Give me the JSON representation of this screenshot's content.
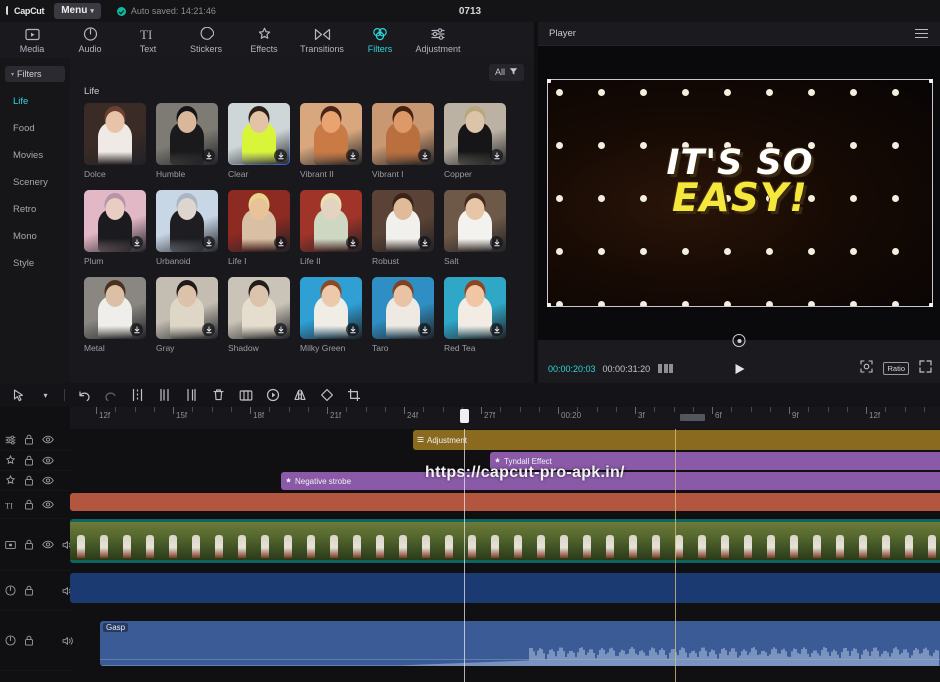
{
  "titlebar": {
    "logo": "CapCut",
    "menu_label": "Menu",
    "menu_caret": "⌄",
    "autosave": "Auto saved: 14:21:46",
    "window_title": "0713"
  },
  "toptabs": [
    {
      "label": "Media",
      "icon": "media-icon",
      "active": false
    },
    {
      "label": "Audio",
      "icon": "audio-icon",
      "active": false
    },
    {
      "label": "Text",
      "icon": "text-icon",
      "active": false
    },
    {
      "label": "Stickers",
      "icon": "stickers-icon",
      "active": false
    },
    {
      "label": "Effects",
      "icon": "effects-icon",
      "active": false
    },
    {
      "label": "Transitions",
      "icon": "transitions-icon",
      "active": false
    },
    {
      "label": "Filters",
      "icon": "filters-icon",
      "active": true
    },
    {
      "label": "Adjustment",
      "icon": "adjustment-icon",
      "active": false
    }
  ],
  "rail": {
    "header": "Filters",
    "items": [
      {
        "label": "Life",
        "active": true
      },
      {
        "label": "Food",
        "active": false
      },
      {
        "label": "Movies",
        "active": false
      },
      {
        "label": "Scenery",
        "active": false
      },
      {
        "label": "Retro",
        "active": false
      },
      {
        "label": "Mono",
        "active": false
      },
      {
        "label": "Style",
        "active": false
      }
    ]
  },
  "grid": {
    "filter_button": "All",
    "filter_icon": "filter-funnel-icon",
    "section_title": "Life",
    "download_icon": "download-icon",
    "items": [
      {
        "label": "Dolce",
        "selected": false,
        "downloadable": false,
        "bg": "#3b2b26",
        "skin": "#e8c3a8",
        "accent": "#f0eae6",
        "hair": "#6a4030"
      },
      {
        "label": "Humble",
        "selected": false,
        "downloadable": true,
        "bg": "#7d7b74",
        "skin": "#d9b79a",
        "accent": "#1a1a1c",
        "hair": "#141416"
      },
      {
        "label": "Clear",
        "selected": true,
        "downloadable": true,
        "bg": "#cfd6d8",
        "skin": "#e2c3a6",
        "accent": "#d8f53a",
        "hair": "#2a2018"
      },
      {
        "label": "Vibrant II",
        "selected": false,
        "downloadable": true,
        "bg": "#d8a77e",
        "skin": "#e8a370",
        "accent": "#c97a45",
        "hair": "#4a2416"
      },
      {
        "label": "Vibrant I",
        "selected": false,
        "downloadable": true,
        "bg": "#c89872",
        "skin": "#dd9a68",
        "accent": "#b96f3e",
        "hair": "#432113"
      },
      {
        "label": "Copper",
        "selected": false,
        "downloadable": true,
        "bg": "#bcb2a4",
        "skin": "#dcc4ab",
        "accent": "#161618",
        "hair": "#b9a77e"
      },
      {
        "label": "Plum",
        "selected": false,
        "downloadable": true,
        "bg": "#e3b8c6",
        "skin": "#e9ccc2",
        "accent": "#1b1b1f",
        "hair": "#b695a6"
      },
      {
        "label": "Urbanoid",
        "selected": false,
        "downloadable": true,
        "bg": "#c8d7e6",
        "skin": "#dfd5cf",
        "accent": "#1d1d22",
        "hair": "#aab6c4"
      },
      {
        "label": "Life I",
        "selected": false,
        "downloadable": true,
        "bg": "#8d2a22",
        "skin": "#e8c39a",
        "accent": "#d9c0a4",
        "hair": "#e8d58a"
      },
      {
        "label": "Life II",
        "selected": false,
        "downloadable": true,
        "bg": "#a03428",
        "skin": "#e4d3c0",
        "accent": "#cdd7c2",
        "hair": "#ece0b2"
      },
      {
        "label": "Robust",
        "selected": false,
        "downloadable": true,
        "bg": "#5a4336",
        "skin": "#e0bb9a",
        "accent": "#f2f0ec",
        "hair": "#3b2318"
      },
      {
        "label": "Salt",
        "selected": false,
        "downloadable": true,
        "bg": "#6e5847",
        "skin": "#e6c6a6",
        "accent": "#f4f2ee",
        "hair": "#45291c"
      },
      {
        "label": "Metal",
        "selected": false,
        "downloadable": true,
        "bg": "#8a8782",
        "skin": "#dcc0a6",
        "accent": "#f0eeea",
        "hair": "#4a3022"
      },
      {
        "label": "Gray",
        "selected": false,
        "downloadable": true,
        "bg": "#c3bdb2",
        "skin": "#ddc2aa",
        "accent": "#ded6c6",
        "hair": "#20191a"
      },
      {
        "label": "Shadow",
        "selected": false,
        "downloadable": true,
        "bg": "#cac4b8",
        "skin": "#dcc3ab",
        "accent": "#e5ddcd",
        "hair": "#231c1c"
      },
      {
        "label": "Milky Green",
        "selected": false,
        "downloadable": true,
        "bg": "#2f9fd4",
        "skin": "#edc9ac",
        "accent": "#f0ece6",
        "hair": "#8a4a26"
      },
      {
        "label": "Taro",
        "selected": false,
        "downloadable": true,
        "bg": "#2f8fc4",
        "skin": "#e9c3a4",
        "accent": "#eee9e2",
        "hair": "#7d4322"
      },
      {
        "label": "Red Tea",
        "selected": false,
        "downloadable": true,
        "bg": "#2fa8c8",
        "skin": "#f0c6a4",
        "accent": "#f2ece4",
        "hair": "#8e4423"
      }
    ]
  },
  "player": {
    "title": "Player",
    "menu_icon": "hamburger-icon",
    "current_time": "00:00:20:03",
    "total_time": "00:00:31:20",
    "layers_icon": "layers-icon",
    "play_icon": "play-icon",
    "zoom_icon": "zoom-fit-icon",
    "ratio_label": "Ratio",
    "fullscreen_icon": "fullscreen-icon",
    "rotate_icon": "rotate-handle-icon",
    "preview": {
      "caption_line1": "IT'S SO",
      "caption_line2": "EASY!",
      "caption_color1": "#ffffff",
      "caption_color2": "#f5e73c"
    }
  },
  "timeline_toolbar": [
    {
      "icon": "cursor-select-icon",
      "name": "select-tool"
    },
    {
      "icon": "chevron-down-icon",
      "name": "tool-dropdown"
    },
    {
      "icon": "undo-icon",
      "name": "undo-button"
    },
    {
      "icon": "redo-icon",
      "name": "redo-button"
    },
    {
      "icon": "split-icon",
      "name": "split-button"
    },
    {
      "icon": "trim-left-icon",
      "name": "trim-left-button"
    },
    {
      "icon": "trim-right-icon",
      "name": "trim-right-button"
    },
    {
      "icon": "delete-icon",
      "name": "delete-button"
    },
    {
      "icon": "freeze-icon",
      "name": "freeze-button"
    },
    {
      "icon": "reverse-icon",
      "name": "reverse-button"
    },
    {
      "icon": "mirror-icon",
      "name": "mirror-button"
    },
    {
      "icon": "rotate-icon",
      "name": "rotate-button"
    },
    {
      "icon": "crop-icon",
      "name": "crop-button"
    }
  ],
  "timeline": {
    "ruler_labels": [
      "12f",
      "15f",
      "18f",
      "21f",
      "24f",
      "27f",
      "00:20",
      "3f",
      "6f",
      "9f",
      "12f"
    ],
    "playhead_position": "00:20",
    "track_headers": [
      {
        "icon": "adjustment-track-icon",
        "name": "adjustment-track",
        "lock": true,
        "eye": true,
        "mute": false
      },
      {
        "icon": "effect-track-icon",
        "name": "effect-track-1",
        "lock": true,
        "eye": true,
        "mute": false
      },
      {
        "icon": "effect-track-icon",
        "name": "effect-track-2",
        "lock": true,
        "eye": true,
        "mute": false
      },
      {
        "icon": "text-track-icon",
        "name": "text-track",
        "lock": true,
        "eye": true,
        "mute": false
      },
      {
        "icon": "video-track-icon",
        "name": "video-track",
        "lock": true,
        "eye": true,
        "mute": true
      },
      {
        "icon": "audio-track-icon",
        "name": "audio-track-1",
        "lock": true,
        "eye": false,
        "mute": true
      },
      {
        "icon": "audio-track-icon",
        "name": "audio-track-2",
        "lock": true,
        "eye": false,
        "mute": true
      }
    ],
    "clips": {
      "adjustment": {
        "label": "Adjustment",
        "icon": "adjustment-clip-icon"
      },
      "tyndall": {
        "label": "Tyndall Effect",
        "icon": "effect-clip-icon"
      },
      "negative": {
        "label": "Negative strobe",
        "icon": "effect-clip-icon"
      },
      "audio": {
        "label": "Gasp"
      }
    }
  },
  "watermark": "https://capcut-pro-apk.in/"
}
